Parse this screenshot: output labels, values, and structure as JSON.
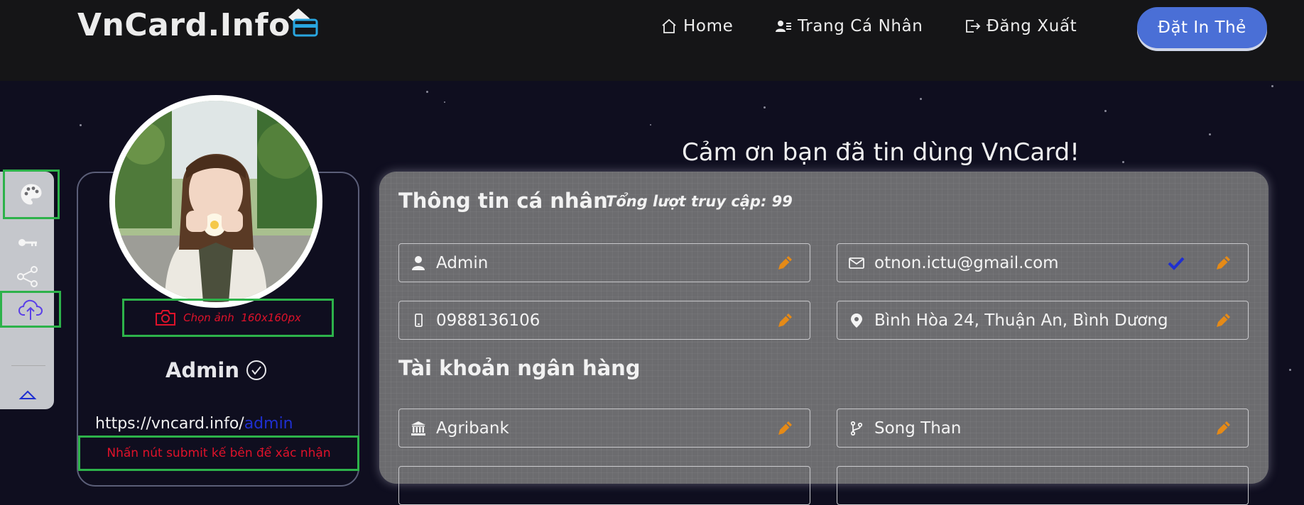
{
  "header": {
    "logo": "VnCard.Info",
    "nav": [
      {
        "label": "Home",
        "icon": "home-icon"
      },
      {
        "label": "Trang Cá Nhân",
        "icon": "user-list-icon"
      },
      {
        "label": "Đăng Xuất",
        "icon": "logout-icon"
      }
    ],
    "order_button": "Đặt In Thẻ"
  },
  "toolbar": {
    "items": [
      {
        "icon": "palette-icon"
      },
      {
        "icon": "key-icon"
      },
      {
        "icon": "share-icon"
      },
      {
        "icon": "cloud-upload-icon"
      },
      {
        "icon": "chevron-up-icon"
      }
    ]
  },
  "profile": {
    "choose_photo_label": "Chọn ảnh  160x160px",
    "name": "Admin",
    "url_prefix": "https://vncard.info/",
    "url_slug": "admin",
    "submit_note": "Nhấn nút submit kế bên để xác nhận"
  },
  "main": {
    "thanks": "Cảm ơn bạn đã tin dùng VnCard!",
    "personal_title": "Thông tin cá nhân",
    "visits": "Tổng lượt truy cập: 99",
    "name_value": "Admin",
    "email_value": "otnon.ictu@gmail.com",
    "phone_value": "0988136106",
    "address_value": "Bình Hòa 24, Thuận An, Bình Dương",
    "bank_title": "Tài khoản ngân hàng",
    "bank_value": "Agribank",
    "branch_value": "Song Than"
  },
  "colors": {
    "accent": "#4a6fd6",
    "edit": "#e58a17",
    "alert": "#e0122a",
    "highlight_box": "#2db24a",
    "verified_check": "#1f2fd1"
  }
}
